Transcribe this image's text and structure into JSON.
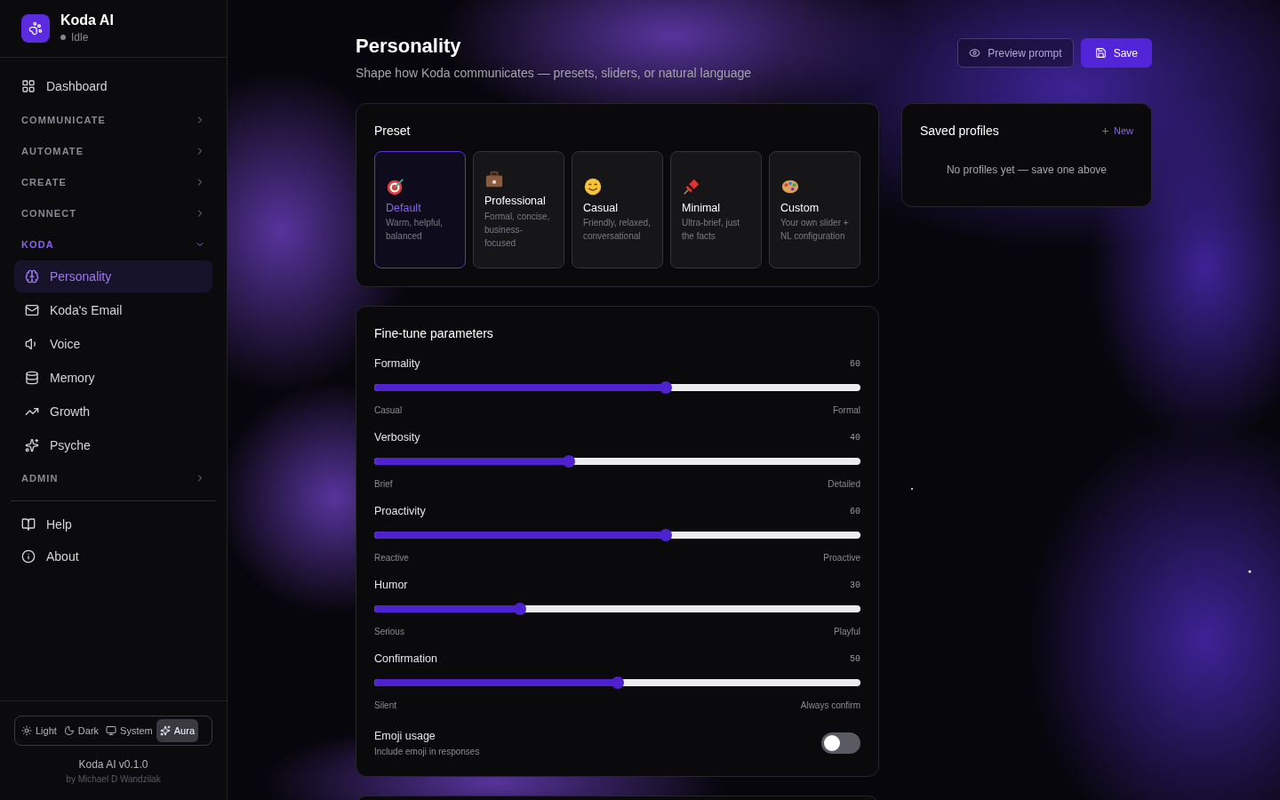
{
  "app": {
    "name": "Koda AI",
    "status": "Idle"
  },
  "nav": [
    {
      "kind": "link",
      "label": "Dashboard",
      "selected": false
    },
    {
      "kind": "section",
      "label": "COMMUNICATE",
      "expanded": false
    },
    {
      "kind": "section",
      "label": "AUTOMATE",
      "expanded": false
    },
    {
      "kind": "section",
      "label": "CREATE",
      "expanded": false
    },
    {
      "kind": "section",
      "label": "CONNECT",
      "expanded": false
    },
    {
      "kind": "section",
      "label": "KODA",
      "expanded": true,
      "children": [
        {
          "label": "Personality",
          "selected": true
        },
        {
          "label": "Koda's Email",
          "selected": false
        },
        {
          "label": "Voice",
          "selected": false
        },
        {
          "label": "Memory",
          "selected": false
        },
        {
          "label": "Growth",
          "selected": false
        },
        {
          "label": "Psyche",
          "selected": false
        }
      ]
    },
    {
      "kind": "section",
      "label": "ADMIN",
      "expanded": false
    }
  ],
  "footer_nav": [
    {
      "label": "Help"
    },
    {
      "label": "About"
    }
  ],
  "themes": [
    {
      "label": "Light",
      "selected": false
    },
    {
      "label": "Dark",
      "selected": false
    },
    {
      "label": "System",
      "selected": false
    },
    {
      "label": "Aura",
      "selected": true
    }
  ],
  "version": "Koda AI v0.1.0",
  "author": "by Michael D Wandzilak",
  "page": {
    "title": "Personality",
    "subtitle": "Shape how Koda communicates — presets, sliders, or natural language",
    "buttons": [
      "Preview prompt",
      "Save"
    ]
  },
  "preset": {
    "title": "Preset",
    "options": [
      {
        "name": "Default",
        "description": "Warm, helpful, balanced",
        "selected": true
      },
      {
        "name": "Professional",
        "description": "Formal, concise, business-focused",
        "selected": false
      },
      {
        "name": "Casual",
        "description": "Friendly, relaxed, conversational",
        "selected": false
      },
      {
        "name": "Minimal",
        "description": "Ultra-brief, just the facts",
        "selected": false
      },
      {
        "name": "Custom",
        "description": "Your own slider + NL configuration",
        "selected": false
      }
    ]
  },
  "fine_tune": {
    "title": "Fine-tune parameters",
    "sliders": [
      {
        "name": "Formality",
        "reading": "60",
        "level": 0.6,
        "min_label": "Casual",
        "max_label": "Formal"
      },
      {
        "name": "Verbosity",
        "reading": "40",
        "level": 0.4,
        "min_label": "Brief",
        "max_label": "Detailed"
      },
      {
        "name": "Proactivity",
        "reading": "60",
        "level": 0.6,
        "min_label": "Reactive",
        "max_label": "Proactive"
      },
      {
        "name": "Humor",
        "reading": "30",
        "level": 0.3,
        "min_label": "Serious",
        "max_label": "Playful"
      },
      {
        "name": "Confirmation",
        "reading": "50",
        "level": 0.5,
        "min_label": "Silent",
        "max_label": "Always confirm"
      }
    ],
    "toggle": {
      "label": "Emoji usage",
      "description": "Include emoji in responses",
      "on": false
    }
  },
  "saved_profiles": {
    "title": "Saved profiles",
    "action": "New",
    "empty": "No profiles yet — save one above"
  }
}
